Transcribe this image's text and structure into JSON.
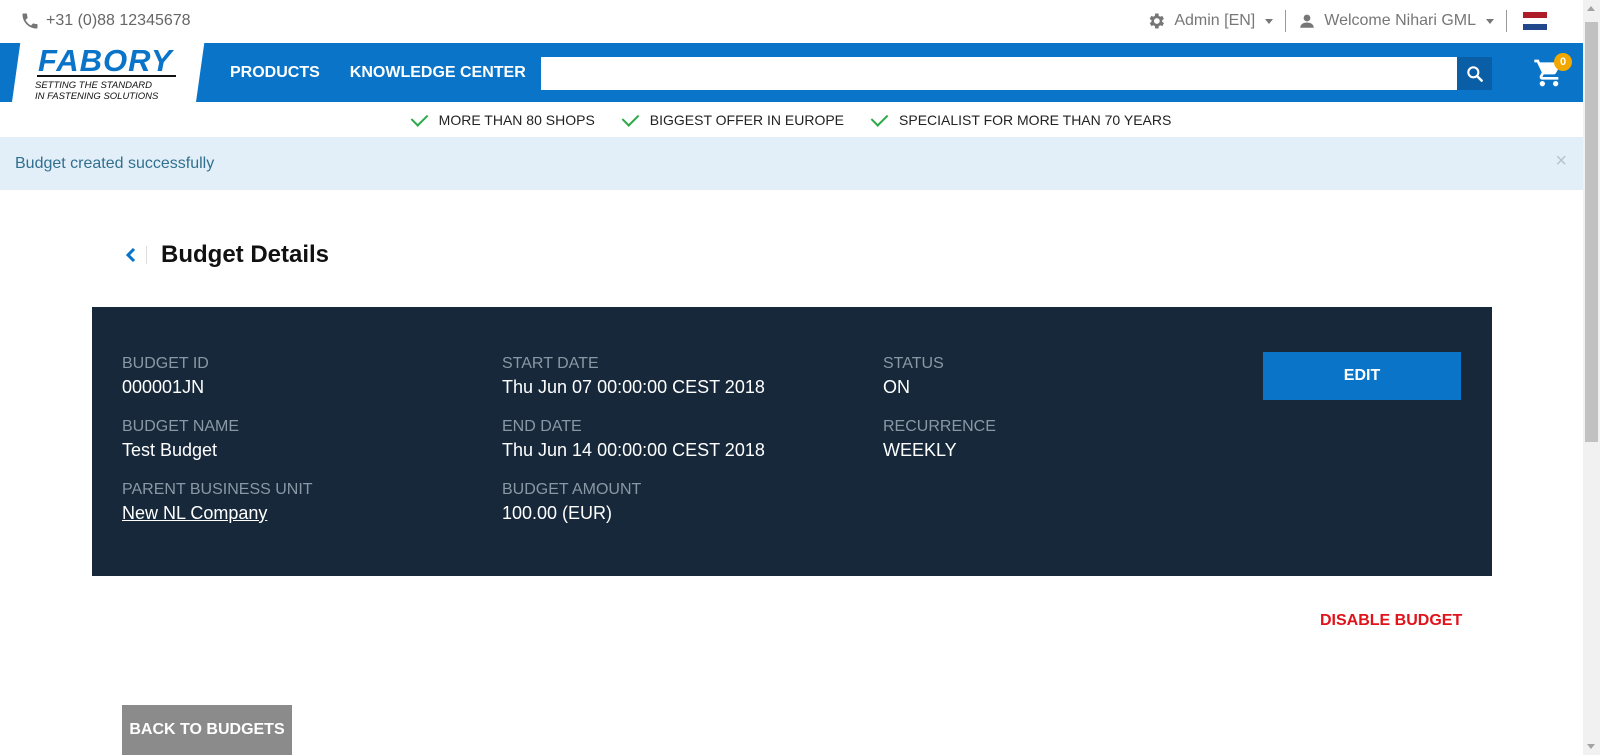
{
  "topbar": {
    "phone": "+31 (0)88 12345678",
    "admin_label": "Admin [EN]",
    "welcome_label": "Welcome Nihari GML"
  },
  "header": {
    "logo_text": "FABORY",
    "logo_tagline_1": "SETTING THE STANDARD",
    "logo_tagline_2": "IN FASTENING SOLUTIONS",
    "nav": [
      "PRODUCTS",
      "KNOWLEDGE CENTER"
    ],
    "search_placeholder": "",
    "cart_count": "0"
  },
  "usps": [
    "MORE THAN 80 SHOPS",
    "BIGGEST OFFER IN EUROPE",
    "SPECIALIST FOR MORE THAN 70 YEARS"
  ],
  "alert": {
    "message": "Budget created successfully",
    "close": "×"
  },
  "page": {
    "title": "Budget Details"
  },
  "details": {
    "budget_id": {
      "label": "BUDGET ID",
      "value": "000001JN"
    },
    "budget_name": {
      "label": "BUDGET NAME",
      "value": "Test Budget"
    },
    "parent_unit": {
      "label": "PARENT BUSINESS UNIT",
      "value": "New NL Company"
    },
    "start_date": {
      "label": "START DATE",
      "value": "Thu Jun 07 00:00:00 CEST 2018"
    },
    "end_date": {
      "label": "END DATE",
      "value": "Thu Jun 14 00:00:00 CEST 2018"
    },
    "amount": {
      "label": "BUDGET AMOUNT",
      "value": "100.00 (EUR)"
    },
    "status": {
      "label": "STATUS",
      "value": "ON"
    },
    "recurrence": {
      "label": "RECURRENCE",
      "value": "WEEKLY"
    },
    "edit_label": "EDIT"
  },
  "actions": {
    "disable_label": "DISABLE BUDGET",
    "back_label": "BACK TO BUDGETS"
  },
  "colors": {
    "brand_blue": "#0a74c9",
    "card_bg": "#16283a",
    "danger": "#e0121a",
    "alert_bg": "#e3eff8"
  }
}
